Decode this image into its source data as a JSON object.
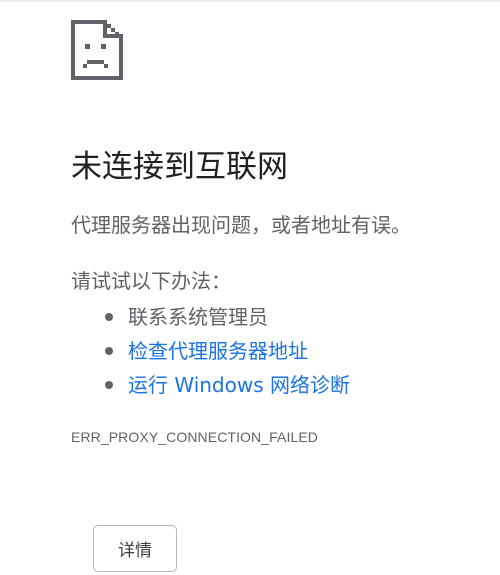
{
  "page": {
    "icon": "broken-page-icon",
    "title": "未连接到互联网",
    "subtitle": "代理服务器出现问题，或者地址有误。",
    "suggestions_heading": "请试试以下办法：",
    "suggestions": [
      {
        "label": "联系系统管理员",
        "is_link": false
      },
      {
        "label": "检查代理服务器地址",
        "is_link": true
      },
      {
        "label": "运行 Windows 网络诊断",
        "is_link": true
      }
    ],
    "error_code": "ERR_PROXY_CONNECTION_FAILED",
    "details_button_label": "详情"
  },
  "colors": {
    "title": "#202124",
    "body_text": "#5f6368",
    "link": "#1a73e8",
    "icon": "#5f6368"
  }
}
